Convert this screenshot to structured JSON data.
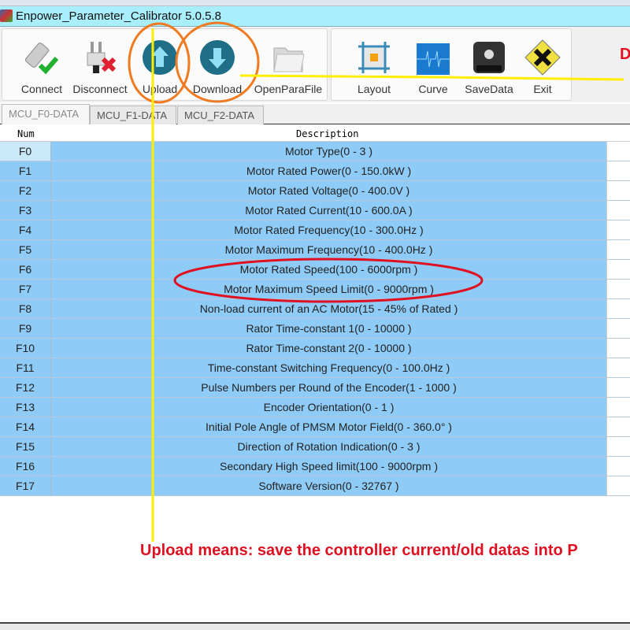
{
  "window": {
    "title": "Enpower_Parameter_Calibrator  5.0.5.8"
  },
  "toolbar": {
    "buttons": [
      {
        "label": "Connect",
        "icon": "connect-plug-check-icon"
      },
      {
        "label": "Disconnect",
        "icon": "disconnect-plug-x-icon"
      },
      {
        "label": "Upload",
        "icon": "upload-arrow-icon"
      },
      {
        "label": "Download",
        "icon": "download-arrow-icon"
      },
      {
        "label": "OpenParaFile",
        "icon": "folder-icon"
      },
      {
        "label": "Layout",
        "icon": "layout-grid-icon"
      },
      {
        "label": "Curve",
        "icon": "curve-waveform-icon"
      },
      {
        "label": "SaveData",
        "icon": "floppy-disk-icon"
      },
      {
        "label": "Exit",
        "icon": "exit-warning-x-icon"
      }
    ]
  },
  "tabs": [
    {
      "label": "MCU_F0-DATA",
      "active": true
    },
    {
      "label": "MCU_F1-DATA"
    },
    {
      "label": "MCU_F2-DATA"
    }
  ],
  "table": {
    "headers": [
      "Num",
      "Description"
    ],
    "rows": [
      [
        "F0",
        "Motor Type(0 - 3 )"
      ],
      [
        "F1",
        "Motor Rated Power(0 - 150.0kW )"
      ],
      [
        "F2",
        "Motor Rated Voltage(0 - 400.0V )"
      ],
      [
        "F3",
        "Motor Rated Current(10 - 600.0A )"
      ],
      [
        "F4",
        "Motor Rated Frequency(10 - 300.0Hz )"
      ],
      [
        "F5",
        "Motor Maximum Frequency(10 - 400.0Hz )"
      ],
      [
        "F6",
        "Motor Rated Speed(100 - 6000rpm )"
      ],
      [
        "F7",
        "Motor Maximum Speed Limit(0 - 9000rpm )"
      ],
      [
        "F8",
        "Non-load current of an AC Motor(15 - 45% of Rated )"
      ],
      [
        "F9",
        "Rator Time-constant 1(0 - 10000 )"
      ],
      [
        "F10",
        "Rator Time-constant 2(0 - 10000 )"
      ],
      [
        "F11",
        "Time-constant Switching Frequency(0 - 100.0Hz )"
      ],
      [
        "F12",
        "Pulse Numbers per Round of the Encoder(1 - 1000 )"
      ],
      [
        "F13",
        "Encoder Orientation(0 - 1 )"
      ],
      [
        "F14",
        "Initial Pole Angle of PMSM Motor Field(0 - 360.0° )"
      ],
      [
        "F15",
        "Direction of Rotation Indication(0 - 3 )"
      ],
      [
        "F16",
        "Secondary High Speed limit(100 - 9000rpm )"
      ],
      [
        "F17",
        "Software Version(0 - 32767 )"
      ]
    ]
  },
  "annotations": {
    "upload_note": "Upload means: save the controller current/old datas into P",
    "download_note_partial": "D",
    "colors": {
      "circle": "#f07a20",
      "line": "#ffee00",
      "ellipse": "#e01020",
      "text": "#e01020"
    }
  }
}
